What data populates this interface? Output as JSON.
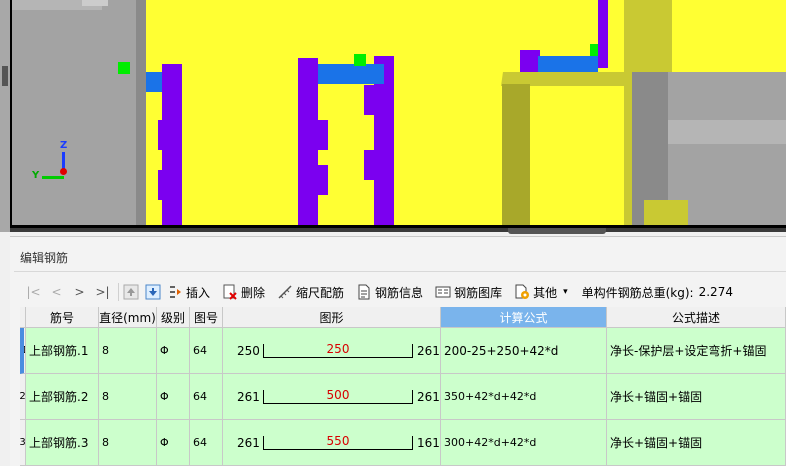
{
  "panel": {
    "title": "编辑钢筋"
  },
  "toolbar": {
    "nav_first": "|<",
    "nav_prev": "<",
    "nav_next": ">",
    "nav_last": ">|",
    "insert": "插入",
    "delete": "删除",
    "scale_rebar": "缩尺配筋",
    "rebar_info": "钢筋信息",
    "rebar_library": "钢筋图库",
    "other": "其他",
    "other_arrow": "▾",
    "total_label": "单构件钢筋总重(kg):",
    "total_value": "2.274"
  },
  "axis": {
    "z": "Z",
    "y": "Y"
  },
  "table": {
    "headers": [
      "筋号",
      "直径(mm)",
      "级别",
      "图号",
      "图形",
      "计算公式",
      "公式描述"
    ],
    "rows": [
      {
        "num": "1",
        "name": "上部钢筋.1",
        "dia": "8",
        "grade": "Φ",
        "fig": "64",
        "left": "250",
        "mid": "250",
        "right": "261",
        "formula": "200-25+250+42*d",
        "desc": "净长-保护层+设定弯折+锚固"
      },
      {
        "num": "2",
        "name": "上部钢筋.2",
        "dia": "8",
        "grade": "Φ",
        "fig": "64",
        "left": "261",
        "mid": "500",
        "right": "261",
        "formula": "350+42*d+42*d",
        "desc": "净长+锚固+锚固"
      },
      {
        "num": "3",
        "name": "上部钢筋.3",
        "dia": "8",
        "grade": "Φ",
        "fig": "64",
        "left": "261",
        "mid": "550",
        "right": "161",
        "formula": "300+42*d+42*d",
        "desc": "净长+锚固+锚固"
      }
    ]
  }
}
